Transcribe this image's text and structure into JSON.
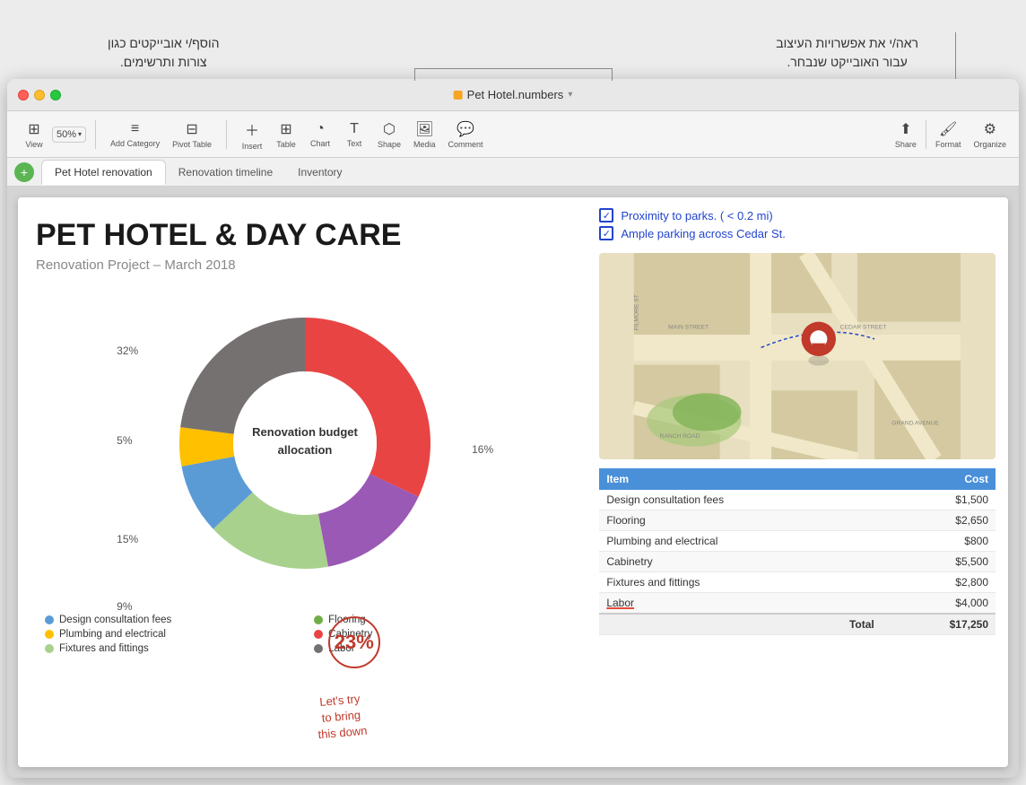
{
  "window": {
    "title": "Pet Hotel.numbers",
    "traffic_lights": [
      "close",
      "minimize",
      "maximize"
    ]
  },
  "toolbar": {
    "view_label": "View",
    "zoom_label": "50%",
    "add_category_label": "Add Category",
    "pivot_table_label": "Pivot Table",
    "insert_label": "Insert",
    "table_label": "Table",
    "chart_label": "Chart",
    "text_label": "Text",
    "shape_label": "Shape",
    "media_label": "Media",
    "comment_label": "Comment",
    "share_label": "Share",
    "format_label": "Format",
    "organize_label": "Organize"
  },
  "tabs": [
    {
      "label": "Pet Hotel renovation",
      "active": true
    },
    {
      "label": "Renovation timeline",
      "active": false
    },
    {
      "label": "Inventory",
      "active": false
    }
  ],
  "presentation": {
    "title": "PET HOTEL & DAY CARE",
    "subtitle": "Renovation Project – March 2018",
    "chart_label": "32%",
    "chart_label2": "5%",
    "chart_label3": "15%",
    "chart_label4": "9%",
    "chart_label5": "16%",
    "chart_center_line1": "Renovation budget",
    "chart_center_line2": "allocation"
  },
  "legend": [
    {
      "label": "Design consultation fees",
      "color": "#5b9bd5"
    },
    {
      "label": "Flooring",
      "color": "#70ad47"
    },
    {
      "label": "Plumbing and electrical",
      "color": "#ffc000"
    },
    {
      "label": "Cabinetry",
      "color": "#e84444"
    },
    {
      "label": "Fixtures and fittings",
      "color": "#a9d18e"
    },
    {
      "label": "Labor",
      "color": "#767171"
    }
  ],
  "donut_segments": [
    {
      "label": "Flooring",
      "color": "#e84444",
      "percent": 32
    },
    {
      "label": "Design consultation fees",
      "color": "#5b9bd5",
      "percent": 9
    },
    {
      "label": "Plumbing",
      "color": "#ffc000",
      "percent": 5
    },
    {
      "label": "Fixtures",
      "color": "#a9d18e",
      "percent": 16
    },
    {
      "label": "Cabinetry",
      "color": "#9b59b6",
      "percent": 15
    },
    {
      "label": "Labor",
      "color": "#767171",
      "percent": 23
    }
  ],
  "handwritten": {
    "note1": "Proximity to parks. ( < 0.2 mi)",
    "note2": "Ample parking across  Cedar St."
  },
  "table": {
    "headers": [
      "Item",
      "Cost"
    ],
    "rows": [
      {
        "item": "Design consultation fees",
        "cost": "$1,500"
      },
      {
        "item": "Flooring",
        "cost": "$2,650"
      },
      {
        "item": "Plumbing and electrical",
        "cost": "$800"
      },
      {
        "item": "Cabinetry",
        "cost": "$5,500"
      },
      {
        "item": "Fixtures and fittings",
        "cost": "$2,800"
      },
      {
        "item": "Labor",
        "cost": "$4,000"
      }
    ],
    "total_label": "Total",
    "total_value": "$17,250"
  },
  "callout": {
    "percent": "23%",
    "note_line1": "Let's try",
    "note_line2": "to bring",
    "note_line3": "this down"
  },
  "annotations": {
    "right_label": "ראה/י את אפשרויות העיצוב\nעבור האובייקט שנבחר.",
    "left_label": "הוסף/י אובייקטים כגון\nצורות ותרשימים."
  }
}
